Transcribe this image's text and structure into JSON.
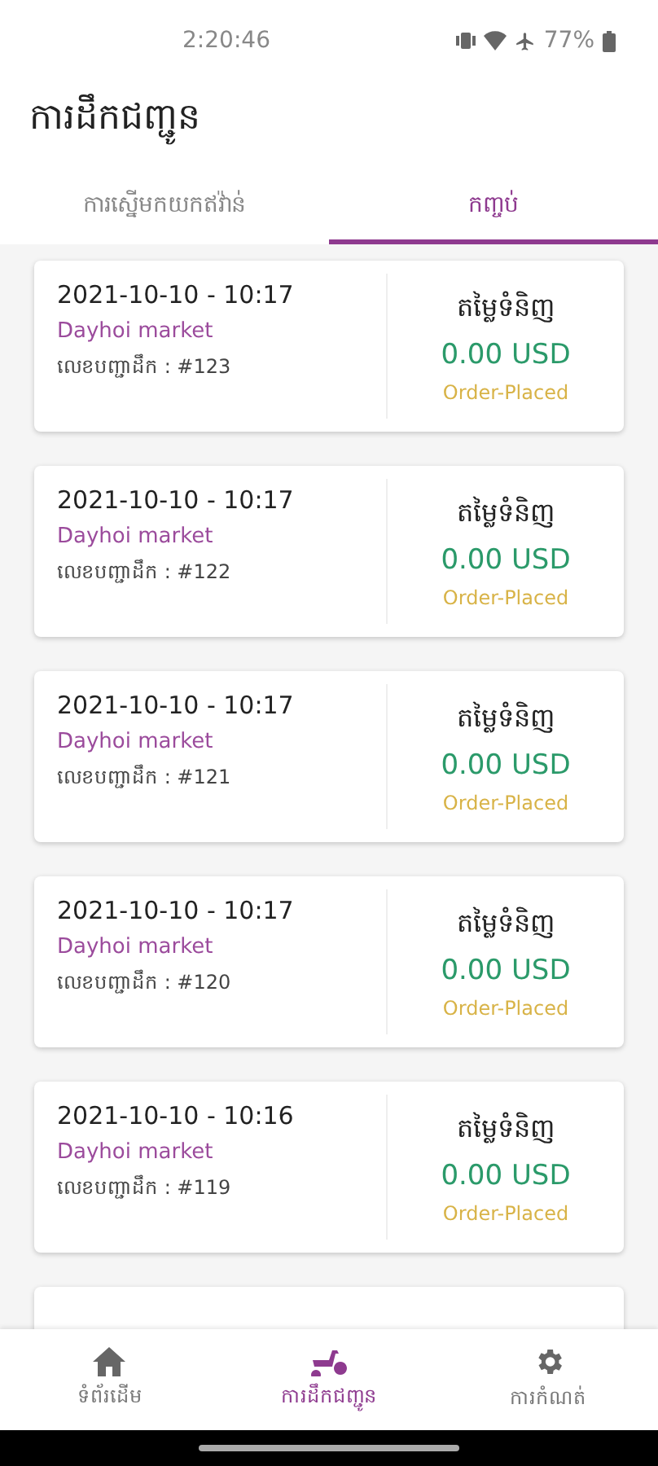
{
  "status_bar": {
    "time": "2:20:46",
    "battery": "77%"
  },
  "title": "ការដឹកជញ្ជូន",
  "tabs": [
    {
      "label": "ការស្នើមកយកឥវ៉ាន់",
      "selected": false
    },
    {
      "label": "កញ្ចប់",
      "selected": true
    }
  ],
  "orders": [
    {
      "datetime": "2021-10-10 - 10:17",
      "store": "Dayhoi market",
      "order_no": "លេខបញ្ជាដឹក : #123",
      "price_label": "តម្លៃទំនិញ",
      "amount": "0.00 USD",
      "status": "Order-Placed"
    },
    {
      "datetime": "2021-10-10 - 10:17",
      "store": "Dayhoi market",
      "order_no": "លេខបញ្ជាដឹក : #122",
      "price_label": "តម្លៃទំនិញ",
      "amount": "0.00 USD",
      "status": "Order-Placed"
    },
    {
      "datetime": "2021-10-10 - 10:17",
      "store": "Dayhoi market",
      "order_no": "លេខបញ្ជាដឹក : #121",
      "price_label": "តម្លៃទំនិញ",
      "amount": "0.00 USD",
      "status": "Order-Placed"
    },
    {
      "datetime": "2021-10-10 - 10:17",
      "store": "Dayhoi market",
      "order_no": "លេខបញ្ជាដឹក : #120",
      "price_label": "តម្លៃទំនិញ",
      "amount": "0.00 USD",
      "status": "Order-Placed"
    },
    {
      "datetime": "2021-10-10 - 10:16",
      "store": "Dayhoi market",
      "order_no": "លេខបញ្ជាដឹក : #119",
      "price_label": "តម្លៃទំនិញ",
      "amount": "0.00 USD",
      "status": "Order-Placed"
    }
  ],
  "bottom_nav": [
    {
      "label": "ទំព័រដើម",
      "kind": "home",
      "selected": false
    },
    {
      "label": "ការដឹកជញ្ជូន",
      "kind": "delivery",
      "selected": true
    },
    {
      "label": "ការកំណត់",
      "kind": "settings",
      "selected": false
    }
  ]
}
